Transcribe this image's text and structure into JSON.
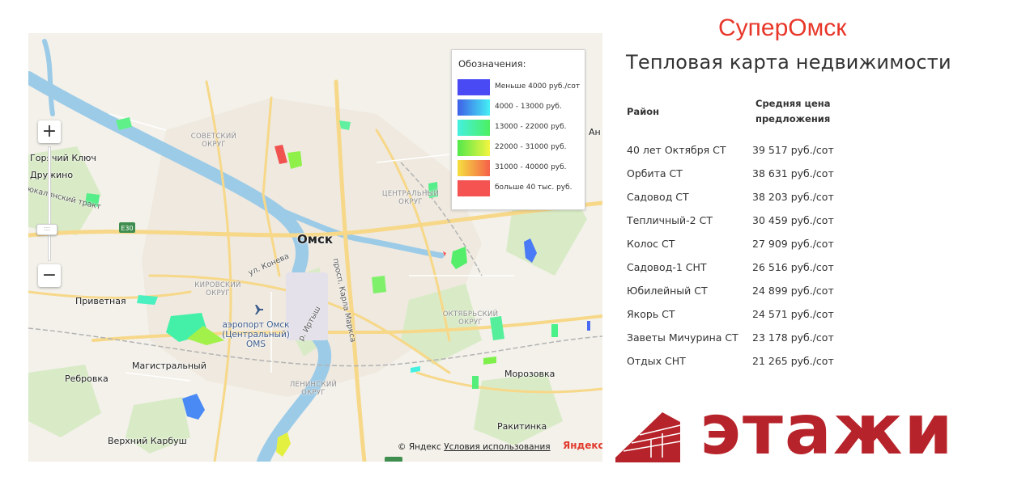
{
  "brand": "СуперОмск",
  "title": "Тепловая карта недвижимости",
  "table": {
    "col_district": "Район",
    "col_price_line1": "Средняя цена",
    "col_price_line2": "предложения",
    "rows": [
      {
        "name": "40 лет Октября СТ",
        "price": "39 517 руб./сот"
      },
      {
        "name": "Орбита СТ",
        "price": "38 631 руб./сот"
      },
      {
        "name": "Садовод СТ",
        "price": "38 203 руб./сот"
      },
      {
        "name": "Тепличный-2 СТ",
        "price": "30 459 руб./сот"
      },
      {
        "name": "Колос СТ",
        "price": "27 909 руб./сот"
      },
      {
        "name": "Садовод-1 СНТ",
        "price": "26 516 руб./сот"
      },
      {
        "name": "Юбилейный СТ",
        "price": "24 899 руб./сот"
      },
      {
        "name": "Якорь СТ",
        "price": "24 571 руб./сот"
      },
      {
        "name": "Заветы Мичурина СТ",
        "price": "23 178 руб./сот"
      },
      {
        "name": "Отдых СНТ",
        "price": "21 265 руб./сот"
      }
    ]
  },
  "legend": {
    "title": "Обозначения:",
    "items": [
      {
        "label": "Меньше 4000 руб./сот",
        "color_from": "#4a4af5",
        "color_to": "#4a4af5"
      },
      {
        "label": "4000 - 13000 руб.",
        "color_from": "#3f5fe8",
        "color_to": "#44f0f5"
      },
      {
        "label": "13000 - 22000 руб.",
        "color_from": "#44f0e0",
        "color_to": "#4cf060"
      },
      {
        "label": "22000 - 31000 руб.",
        "color_from": "#52e84a",
        "color_to": "#f5f540"
      },
      {
        "label": "31000 - 40000 руб.",
        "color_from": "#f5e040",
        "color_to": "#f5604a"
      },
      {
        "label": "больше 40 тыс. руб.",
        "color_from": "#f55252",
        "color_to": "#f55252"
      }
    ]
  },
  "map": {
    "labels": {
      "omsk": "Омск",
      "sovetsky": "СОВЕТСКИЙ ОКРУГ",
      "centralny": "ЦЕНТРАЛЬНЫЙ ОКРУГ",
      "kirovsky": "КИРОВСКИЙ ОКРУГ",
      "oktyabrsky": "ОКТЯБРЬСКИЙ ОКРУГ",
      "leninsky": "ЛЕНИНСКИЙ ОКРУГ",
      "goryachy_klyuch": "Горячий Ключ",
      "druzhino": "Дружино",
      "tyukalinsky": "Тюкалинский тракт",
      "privetnaya": "Приветная",
      "rebrovka": "Ребровка",
      "magistralny": "Магистральный",
      "verkhny_karbush": "Верхний Карбуш",
      "morozovka": "Морозовка",
      "rakitinka": "Ракитинка",
      "an": "Ан",
      "airport": "аэропорт Омск (Центральный) OMS",
      "ul_koneva": "ул. Конева",
      "pr_karla_marksa": "просп. Карла Маркса",
      "r_irtysh": "р. Иртыш",
      "e30": "E30"
    },
    "copyright_prefix": "© Яндекс",
    "copyright_terms": "Условия использования",
    "yandex_logo": "Яндекс",
    "zoom_in": "+",
    "zoom_out": "−",
    "zoom_handle": ":::"
  },
  "etazhi": "этажи",
  "colors": {
    "brand_red": "#e8372a",
    "etazhi_red": "#b7232a",
    "river": "#9ccbe8",
    "road": "#f7d889",
    "park": "#d8ebc4"
  }
}
